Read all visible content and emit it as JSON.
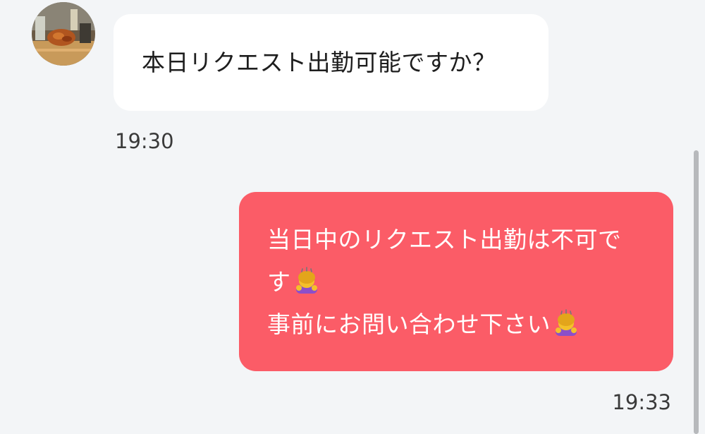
{
  "messages": {
    "incoming": {
      "text": "本日リクエスト出勤可能ですか？",
      "time": "19:30",
      "avatar_icon": "food-photo-avatar"
    },
    "outgoing": {
      "line1": "当日中のリクエスト出勤は不可で",
      "line2": "す",
      "line3": "事前にお問い合わせ下さい",
      "emoji": "person-bowing-icon",
      "time": "19:33"
    }
  },
  "colors": {
    "background": "#f3f5f7",
    "incoming_bubble": "#ffffff",
    "outgoing_bubble": "#fb5c67",
    "scrollbar": "#b7b9bc"
  }
}
